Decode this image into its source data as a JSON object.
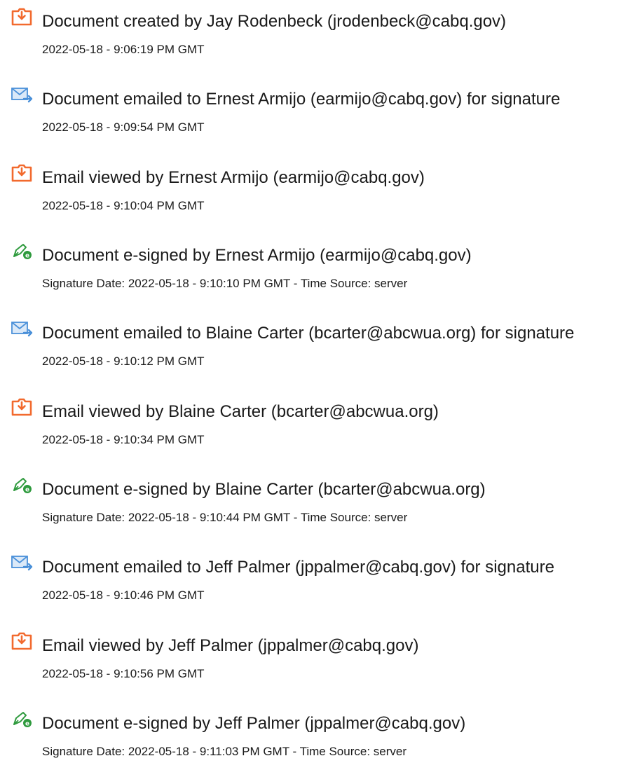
{
  "colors": {
    "created_icon": "#f26a2e",
    "email_icon": "#4a90d9",
    "signed_icon": "#2e9a3d"
  },
  "events": [
    {
      "icon": "document-created-icon",
      "title": "Document created by Jay Rodenbeck (jrodenbeck@cabq.gov)",
      "detail": "2022-05-18 - 9:06:19 PM GMT"
    },
    {
      "icon": "email-sent-icon",
      "title": "Document emailed to Ernest Armijo (earmijo@cabq.gov) for signature",
      "detail": "2022-05-18 - 9:09:54 PM GMT"
    },
    {
      "icon": "document-created-icon",
      "title": "Email viewed by Ernest Armijo (earmijo@cabq.gov)",
      "detail": "2022-05-18 - 9:10:04 PM GMT"
    },
    {
      "icon": "e-sign-icon",
      "title": "Document e-signed by Ernest Armijo (earmijo@cabq.gov)",
      "detail": "Signature Date: 2022-05-18 - 9:10:10 PM GMT - Time Source: server"
    },
    {
      "icon": "email-sent-icon",
      "title": "Document emailed to Blaine Carter (bcarter@abcwua.org) for signature",
      "detail": "2022-05-18 - 9:10:12 PM GMT"
    },
    {
      "icon": "document-created-icon",
      "title": "Email viewed by Blaine Carter (bcarter@abcwua.org)",
      "detail": "2022-05-18 - 9:10:34 PM GMT"
    },
    {
      "icon": "e-sign-icon",
      "title": "Document e-signed by Blaine Carter (bcarter@abcwua.org)",
      "detail": "Signature Date: 2022-05-18 - 9:10:44 PM GMT - Time Source: server"
    },
    {
      "icon": "email-sent-icon",
      "title": "Document emailed to Jeff Palmer (jppalmer@cabq.gov) for signature",
      "detail": "2022-05-18 - 9:10:46 PM GMT"
    },
    {
      "icon": "document-created-icon",
      "title": "Email viewed by Jeff Palmer (jppalmer@cabq.gov)",
      "detail": "2022-05-18 - 9:10:56 PM GMT"
    },
    {
      "icon": "e-sign-icon",
      "title": "Document e-signed by Jeff Palmer (jppalmer@cabq.gov)",
      "detail": "Signature Date: 2022-05-18 - 9:11:03 PM GMT - Time Source: server"
    }
  ]
}
